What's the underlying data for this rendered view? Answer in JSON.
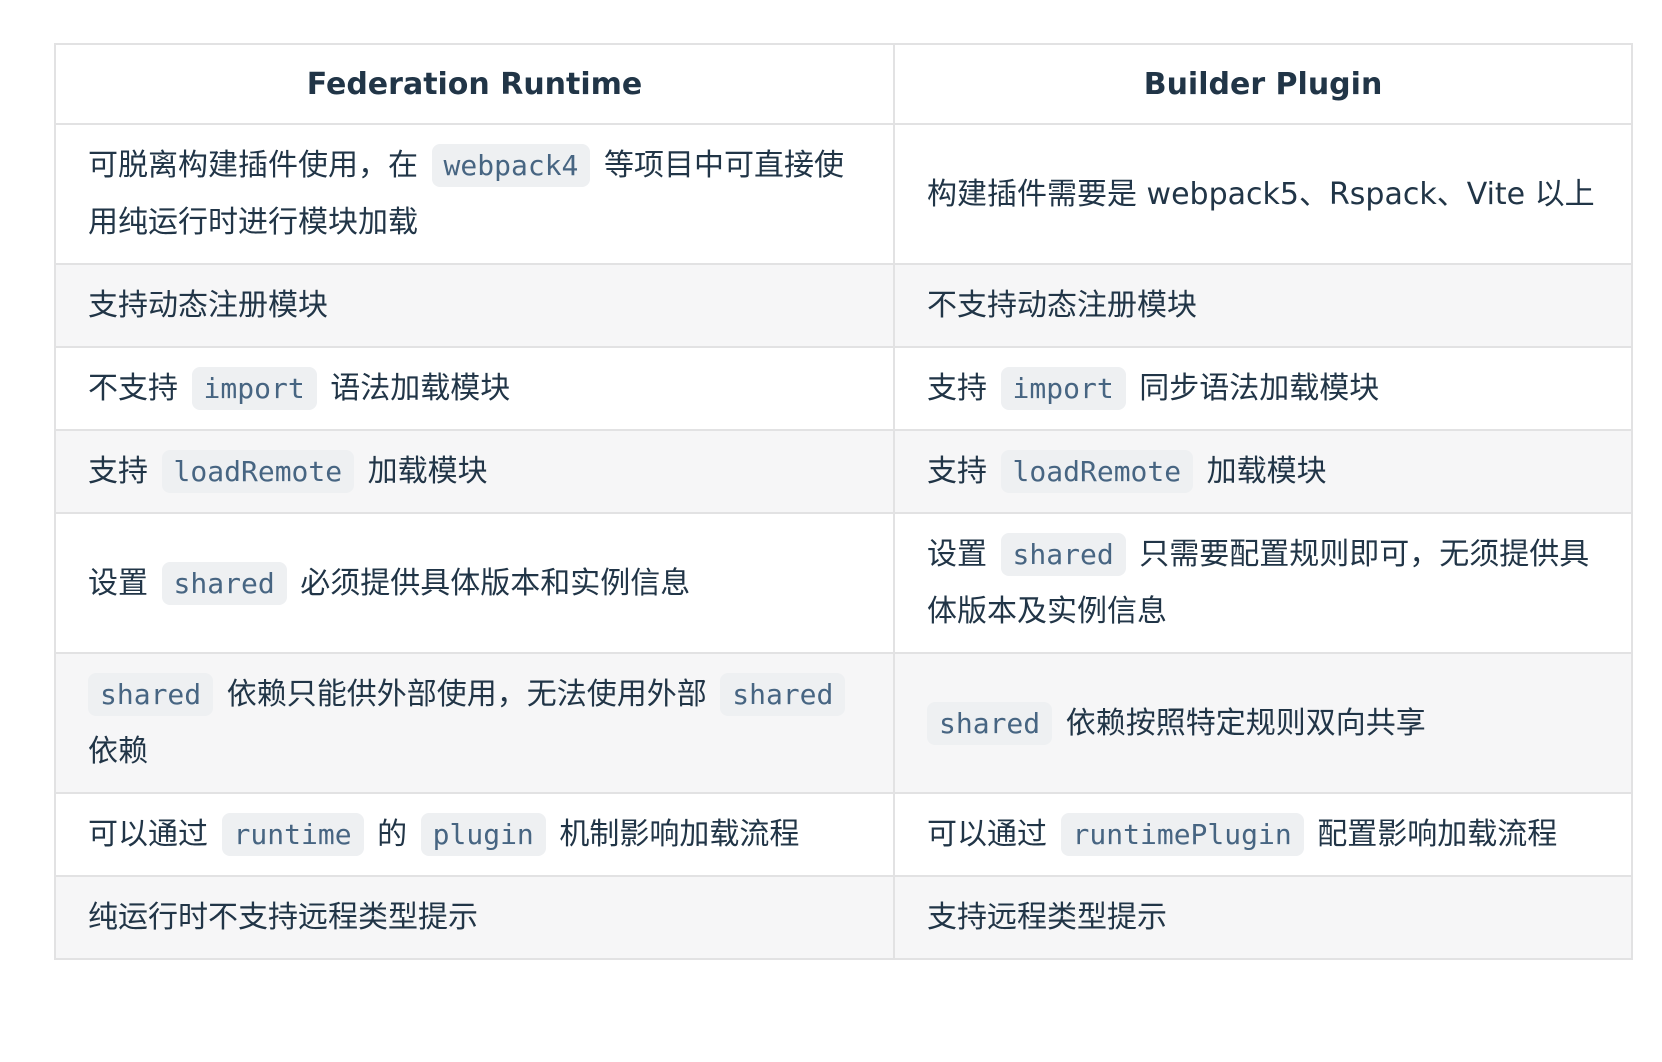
{
  "table": {
    "headers": [
      "Federation Runtime",
      "Builder Plugin"
    ],
    "rows": [
      {
        "runtime": [
          {
            "t": "text",
            "v": "可脱离构建插件使用，在 "
          },
          {
            "t": "code",
            "v": "webpack4"
          },
          {
            "t": "text",
            "v": " 等项目中可直接使用纯运行时进行模块加载"
          }
        ],
        "plugin": [
          {
            "t": "text",
            "v": "构建插件需要是 webpack5、Rspack、Vite 以上"
          }
        ]
      },
      {
        "runtime": [
          {
            "t": "text",
            "v": "支持动态注册模块"
          }
        ],
        "plugin": [
          {
            "t": "text",
            "v": "不支持动态注册模块"
          }
        ]
      },
      {
        "runtime": [
          {
            "t": "text",
            "v": "不支持 "
          },
          {
            "t": "code",
            "v": "import"
          },
          {
            "t": "text",
            "v": " 语法加载模块"
          }
        ],
        "plugin": [
          {
            "t": "text",
            "v": "支持 "
          },
          {
            "t": "code",
            "v": "import"
          },
          {
            "t": "text",
            "v": " 同步语法加载模块"
          }
        ]
      },
      {
        "runtime": [
          {
            "t": "text",
            "v": "支持 "
          },
          {
            "t": "code",
            "v": "loadRemote"
          },
          {
            "t": "text",
            "v": " 加载模块"
          }
        ],
        "plugin": [
          {
            "t": "text",
            "v": "支持 "
          },
          {
            "t": "code",
            "v": "loadRemote"
          },
          {
            "t": "text",
            "v": " 加载模块"
          }
        ]
      },
      {
        "runtime": [
          {
            "t": "text",
            "v": "设置 "
          },
          {
            "t": "code",
            "v": "shared"
          },
          {
            "t": "text",
            "v": " 必须提供具体版本和实例信息"
          }
        ],
        "plugin": [
          {
            "t": "text",
            "v": "设置 "
          },
          {
            "t": "code",
            "v": "shared"
          },
          {
            "t": "text",
            "v": " 只需要配置规则即可，无须提供具体版本及实例信息"
          }
        ]
      },
      {
        "runtime": [
          {
            "t": "code",
            "v": "shared"
          },
          {
            "t": "text",
            "v": " 依赖只能供外部使用，无法使用外部 "
          },
          {
            "t": "code",
            "v": "shared"
          },
          {
            "t": "text",
            "v": " 依赖"
          }
        ],
        "plugin": [
          {
            "t": "code",
            "v": "shared"
          },
          {
            "t": "text",
            "v": " 依赖按照特定规则双向共享"
          }
        ]
      },
      {
        "runtime": [
          {
            "t": "text",
            "v": "可以通过 "
          },
          {
            "t": "code",
            "v": "runtime"
          },
          {
            "t": "text",
            "v": " 的 "
          },
          {
            "t": "code",
            "v": "plugin"
          },
          {
            "t": "text",
            "v": " 机制影响加载流程"
          }
        ],
        "plugin": [
          {
            "t": "text",
            "v": "可以通过 "
          },
          {
            "t": "code",
            "v": "runtimePlugin"
          },
          {
            "t": "text",
            "v": " 配置影响加载流程"
          }
        ]
      },
      {
        "runtime": [
          {
            "t": "text",
            "v": "纯运行时不支持远程类型提示"
          }
        ],
        "plugin": [
          {
            "t": "text",
            "v": "支持远程类型提示"
          }
        ]
      }
    ]
  }
}
